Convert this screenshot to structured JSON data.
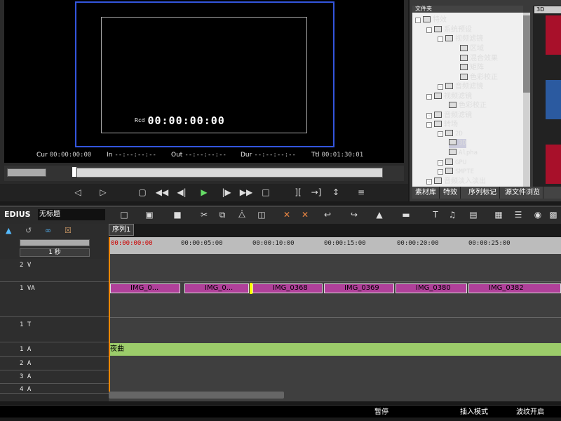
{
  "player": {
    "rcd_label": "Rcd",
    "rcd_timecode": "00:00:00:00",
    "cur_label": "Cur",
    "cur_value": "00:00:00:00",
    "in_label": "In",
    "in_value": "--:--:--:--",
    "out_label": "Out",
    "out_value": "--:--:--:--",
    "dur_label": "Dur",
    "dur_value": "--:--:--:--",
    "ttl_label": "Ttl",
    "ttl_value": "00:01:30:01"
  },
  "effects": {
    "header": "文件夹",
    "tree": [
      "特效",
      "系统预设",
      "视频滤镜",
      "区域",
      "混合效果",
      "矩阵",
      "色彩校正",
      "音频滤镜",
      "视频滤镜",
      "色彩校正",
      "音频滤镜",
      "转场",
      "2D",
      "3D",
      "Alpha",
      "GPU",
      "SMPTE",
      "音频淡入淡出"
    ],
    "tabs": [
      "素材库",
      "特效",
      "序列标记",
      "源文件浏览"
    ],
    "thumb_label": "3D"
  },
  "timeline": {
    "app_label": "EDIUS",
    "project_name": "无标题",
    "sequence_tab": "序列1",
    "zoom_label": "1 秒",
    "ruler": [
      "00:00:00:00",
      "00:00:05:00",
      "00:00:10:00",
      "00:00:15:00",
      "00:00:20:00",
      "00:00:25:00"
    ],
    "tracks": {
      "v2": "2 V",
      "va1": "1 VA",
      "t1": "1 T",
      "a1": "1 A",
      "a2": "2 A",
      "a3": "3 A",
      "a4": "4 A"
    },
    "clips": [
      "IMG_0...",
      "IMG_0...",
      "IMG_0368",
      "IMG_0369",
      "IMG_0380",
      "IMG_0382"
    ],
    "audio_clip": "夜曲"
  },
  "status": {
    "pause": "暂停",
    "insert_mode": "插入模式",
    "ripple": "波纹开启"
  }
}
